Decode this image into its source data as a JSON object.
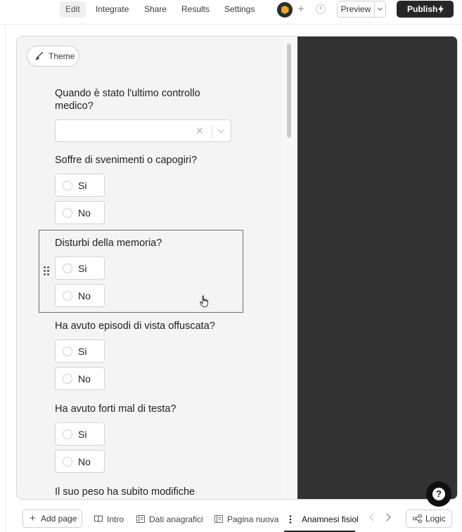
{
  "topnav": {
    "tabs": [
      {
        "label": "Edit",
        "active": true
      },
      {
        "label": "Integrate",
        "active": false
      },
      {
        "label": "Share",
        "active": false
      },
      {
        "label": "Results",
        "active": false
      },
      {
        "label": "Settings",
        "active": false
      }
    ],
    "preview_label": "Preview",
    "publish_label": "Publish",
    "publish_color": "#262627",
    "avatar_color": "#e9a825"
  },
  "editor": {
    "theme_label": "Theme",
    "preview_background": "#323232",
    "questions": [
      {
        "title": "Quando è stato l'ultimo controllo medico?",
        "type": "dropdown",
        "value": ""
      },
      {
        "title": "Soffre di svenimenti o capogiri?",
        "type": "radio",
        "options": [
          "Si",
          "No"
        ]
      },
      {
        "title": "Disturbi della memoria?",
        "type": "radio",
        "options": [
          "Si",
          "No"
        ],
        "selected": true
      },
      {
        "title": "Ha avuto episodi di vista offuscata?",
        "type": "radio",
        "options": [
          "Si",
          "No"
        ]
      },
      {
        "title": "Ha avuto forti mal di testa?",
        "type": "radio",
        "options": [
          "Si",
          "No"
        ]
      },
      {
        "title": "Il suo peso ha subito modifiche",
        "type": "radio",
        "options": []
      }
    ]
  },
  "pages": {
    "add_label": "Add page",
    "tabs": [
      {
        "label": "Intro",
        "icon": "book-icon"
      },
      {
        "label": "Dati anagrafici",
        "icon": "page-icon"
      },
      {
        "label": "Pagina nuova",
        "icon": "page-icon"
      },
      {
        "label": "Anamnesi fisiol",
        "icon": "dots-vertical-icon",
        "active": true
      }
    ],
    "logic_label": "Logic"
  },
  "help": {
    "glyph": "?"
  }
}
